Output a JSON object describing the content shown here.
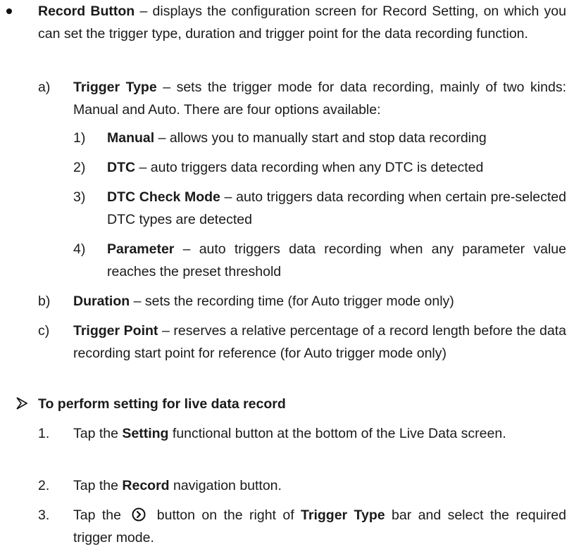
{
  "record_button": {
    "term": "Record Button",
    "text": " – displays the configuration screen for Record Setting, on which you can set the trigger type, duration and trigger point for the data recording function."
  },
  "sub_items": [
    {
      "marker": "a)",
      "term": "Trigger Type",
      "text": " – sets the trigger mode for data recording, mainly of two kinds: Manual and Auto. There are four options available:"
    },
    {
      "marker": "b)",
      "term": "Duration",
      "text": " – sets the recording time (for Auto trigger mode only)"
    },
    {
      "marker": "c)",
      "term": "Trigger Point",
      "text": " – reserves a relative percentage of a record length before the data recording start point for reference (for Auto trigger mode only)"
    }
  ],
  "trigger_options": [
    {
      "marker": "1)",
      "term": "Manual",
      "text": " – allows you to manually start and stop data recording"
    },
    {
      "marker": "2)",
      "term": "DTC",
      "text": " – auto triggers data recording when any DTC is detected"
    },
    {
      "marker": "3)",
      "term": "DTC Check Mode",
      "text": " – auto triggers data recording when certain pre-selected DTC types are detected"
    },
    {
      "marker": "4)",
      "term": "Parameter",
      "text": " – auto triggers data recording when any parameter value reaches the preset threshold"
    }
  ],
  "procedure": {
    "heading": "To perform setting for live data record",
    "steps": [
      {
        "marker": "1.",
        "pre": "Tap the ",
        "bold": "Setting",
        "post": " functional button at the bottom of the Live Data screen."
      },
      {
        "marker": "2.",
        "pre": "Tap the ",
        "bold": "Record",
        "post": " navigation button."
      },
      {
        "marker": "3.",
        "pre": "Tap the ",
        "post_icon": " button on the right of ",
        "bold": "Trigger Type",
        "post": " bar and select the required trigger mode."
      }
    ]
  },
  "icons": {
    "bullet": "bullet-icon",
    "arrow": "arrow-bullet-icon",
    "next": "circle-chevron-right-icon"
  }
}
